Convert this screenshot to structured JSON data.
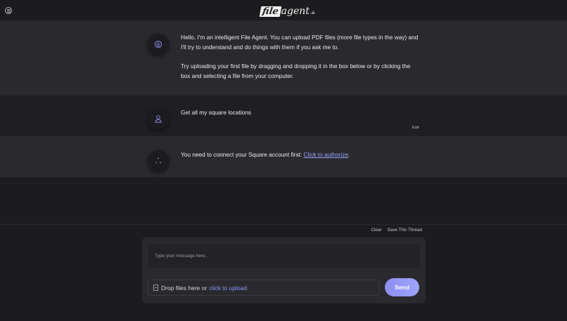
{
  "header": {
    "logo_file": "file",
    "logo_agent": "agent",
    "logo_ai": ".ai"
  },
  "messages": [
    {
      "role": "assistant",
      "paragraphs": [
        "Hello, I'm an intelligent File Agent. You can upload PDF files (more file types in the way) and I'll try to understand and do things with them if you ask me to.",
        "Try uploading your first file by dragging and dropping it in the box below or by clicking the box and selecting a file from your computer."
      ]
    },
    {
      "role": "user",
      "text": "Get all my square locations",
      "edit_label": "Edit"
    },
    {
      "role": "assistant",
      "text_before": "You need to connect your Square account first: ",
      "link_label": "Click to authorize",
      "text_after": "."
    }
  ],
  "thread_actions": {
    "clear_label": "Clear",
    "save_label": "Save This Thread"
  },
  "composer": {
    "placeholder": "Type your message here...",
    "value": "",
    "drop_text": "Drop files here or",
    "upload_link": "click to upload",
    "send_label": "Send"
  },
  "icons": {
    "menu": "menu-circle-icon",
    "assistant_avatar": "brain-icon",
    "user_avatar": "user-icon",
    "loading": "loading-dots-icon",
    "file": "file-icon"
  },
  "colors": {
    "accent": "#9aa0ff",
    "send_button": "#9699f7"
  }
}
